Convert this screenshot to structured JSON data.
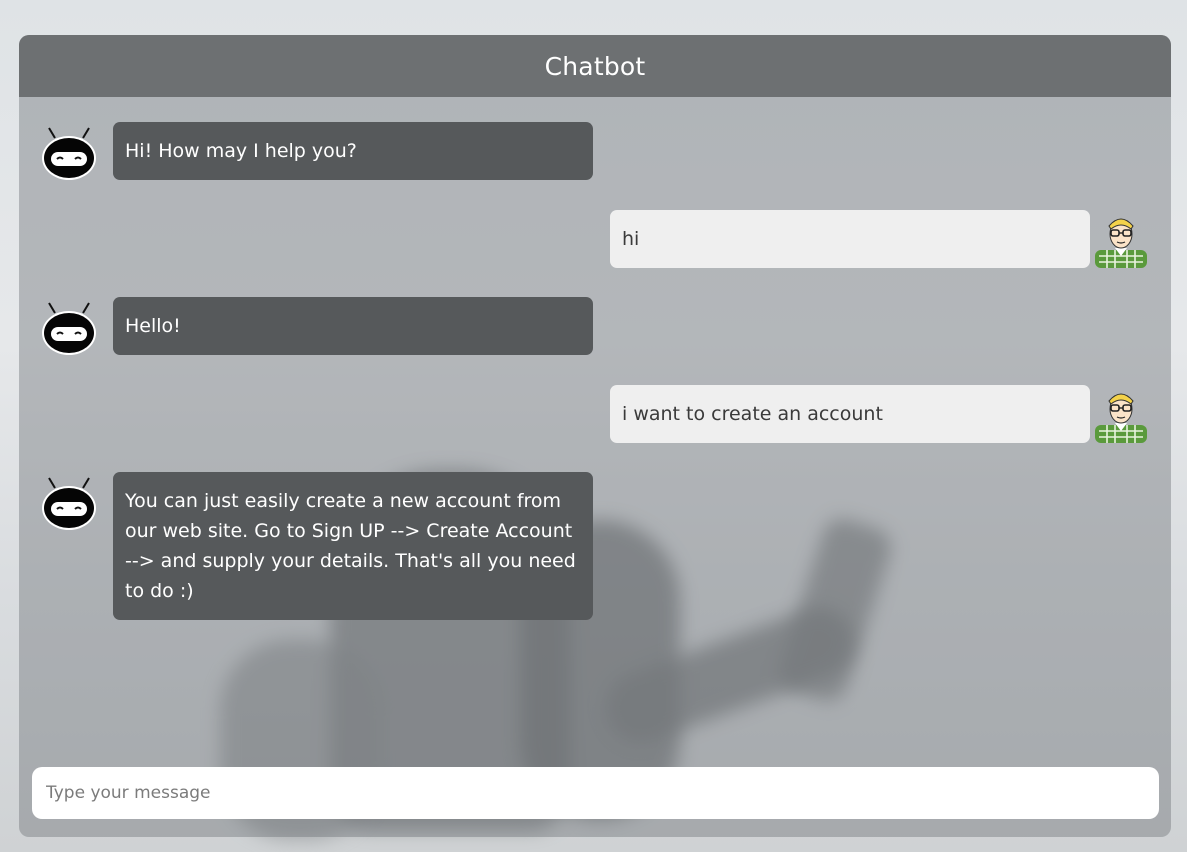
{
  "header": {
    "title": "Chatbot"
  },
  "messages": [
    {
      "sender": "bot",
      "text": "Hi! How may I help you?"
    },
    {
      "sender": "user",
      "text": "hi"
    },
    {
      "sender": "bot",
      "text": "Hello!"
    },
    {
      "sender": "user",
      "text": "i want to create an account"
    },
    {
      "sender": "bot",
      "text": "You can just easily create a new account from our web site. Go to Sign UP --> Create Account --> and supply your details. That's all you need to do :)"
    }
  ],
  "input": {
    "placeholder": "Type your message",
    "value": ""
  },
  "icons": {
    "bot_avatar": "robot-face-icon",
    "user_avatar": "user-cartoon-icon"
  },
  "colors": {
    "bot_bubble": "#56595b",
    "user_bubble": "#efefef",
    "header": "#6d7072"
  }
}
